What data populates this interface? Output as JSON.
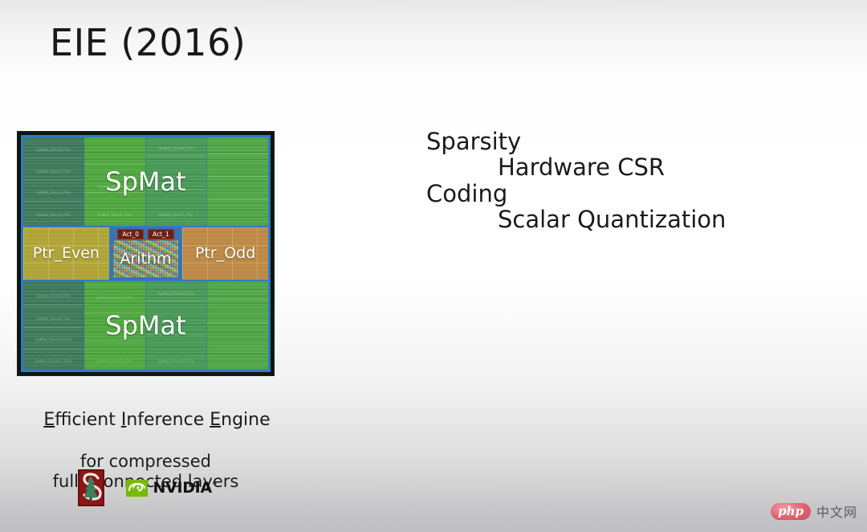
{
  "slide": {
    "title": "EIE (2016)"
  },
  "notes": {
    "lines": [
      {
        "text": "Sparsity",
        "indent": false
      },
      {
        "text": "Hardware CSR",
        "indent": true
      },
      {
        "text": "Coding",
        "indent": false
      },
      {
        "text": "Scalar Quantization",
        "indent": true
      }
    ]
  },
  "chip": {
    "top_bank_label": "SpMat",
    "bottom_bank_label": "SpMat",
    "ptr_even_label": "Ptr_Even",
    "ptr_odd_label": "Ptr_Odd",
    "arith_label": "Arithm",
    "act_badges": [
      "Act_0",
      "Act_1"
    ],
    "micro_labels_top": [
      "SpMat_Slice0_Fifo",
      "SpMat_Slice1_Fifo",
      "SpMat_Slice2_Fifo",
      "SpMat_Slice3_Fifo",
      "SpMat_Slice4_Fifo",
      "SpMat_Slice5_Fifo",
      "SpMat_Slice6_Fifo",
      "SpMat_Slice7_Fifo"
    ],
    "micro_labels_bottom": [
      "SpMat_Slice8_Fifo",
      "SpMat_Slice9_Fifo",
      "SpMat_Slice10_Fifo",
      "SpMat_Slice11_Fifo",
      "SpMat_Slice12_Fifo",
      "SpMat_Slice13_Fifo",
      "SpMat_Slice14_Fifo",
      "SpMat_Slice15_Fifo"
    ],
    "colors": {
      "bank_dark": "#3f7a5c",
      "bank_bright": "#4fa83f",
      "ptr_even": "#b3a73a",
      "ptr_odd": "#c08c48",
      "frame_blue": "#2f7bc4",
      "act_badge": "#6e1f14"
    }
  },
  "caption": {
    "line1_parts": [
      {
        "t": "E",
        "u": true
      },
      {
        "t": "fficient ",
        "u": false
      },
      {
        "t": "I",
        "u": true
      },
      {
        "t": "nference ",
        "u": false
      },
      {
        "t": "E",
        "u": true
      },
      {
        "t": "ngine",
        "u": false
      }
    ],
    "line1_plain": "Efficient Inference Engine",
    "line2": "for compressed",
    "line3": "fully connected layers"
  },
  "logos": {
    "stanford": {
      "name": "stanford-logo",
      "color": "#8c1515",
      "tree_color": "#3d7f5e"
    },
    "nvidia": {
      "name": "nvidia-logo",
      "wordmark": "NVIDIA",
      "mark_color": "#76b900",
      "trademark": "™"
    }
  },
  "watermark": {
    "php_text": "php",
    "cn_text": "中文网",
    "php_color": "#d9566a"
  }
}
